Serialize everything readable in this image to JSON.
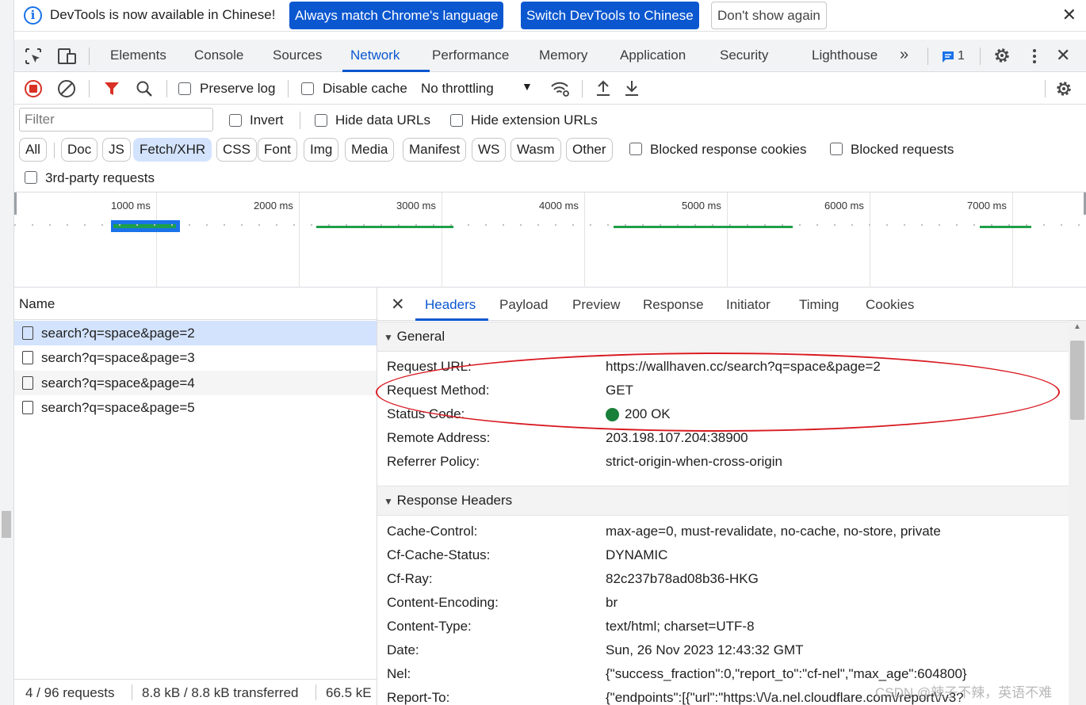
{
  "infobar": {
    "message": "DevTools is now available in Chinese!",
    "btn_match": "Always match Chrome's language",
    "btn_switch": "Switch DevTools to Chinese",
    "btn_dont_show": "Don't show again"
  },
  "tabs": [
    "Elements",
    "Console",
    "Sources",
    "Network",
    "Performance",
    "Memory",
    "Application",
    "Security",
    "Lighthouse"
  ],
  "tabs_issue_count": "1",
  "toolbar": {
    "preserve_log": "Preserve log",
    "disable_cache": "Disable cache",
    "throttling": "No throttling"
  },
  "filter": {
    "placeholder": "Filter",
    "invert": "Invert",
    "hide_data_urls": "Hide data URLs",
    "hide_extension_urls": "Hide extension URLs",
    "types": [
      "All",
      "Doc",
      "JS",
      "Fetch/XHR",
      "CSS",
      "Font",
      "Img",
      "Media",
      "Manifest",
      "WS",
      "Wasm",
      "Other"
    ],
    "blocked_response_cookies": "Blocked response cookies",
    "blocked_requests": "Blocked requests",
    "third_party": "3rd-party requests"
  },
  "overview": {
    "ticks": [
      "1000 ms",
      "2000 ms",
      "3000 ms",
      "4000 ms",
      "5000 ms",
      "6000 ms",
      "7000 ms"
    ]
  },
  "requests": {
    "header": "Name",
    "items": [
      "search?q=space&page=2",
      "search?q=space&page=3",
      "search?q=space&page=4",
      "search?q=space&page=5"
    ],
    "status_count": "4 / 96 requests",
    "status_transferred": "8.8 kB / 8.8 kB transferred",
    "status_resources": "66.5 kE"
  },
  "detail": {
    "tabs": [
      "Headers",
      "Payload",
      "Preview",
      "Response",
      "Initiator",
      "Timing",
      "Cookies"
    ],
    "general_title": "General",
    "general": [
      {
        "k": "Request URL:",
        "v": "https://wallhaven.cc/search?q=space&page=2"
      },
      {
        "k": "Request Method:",
        "v": "GET"
      },
      {
        "k": "Status Code:",
        "v": "200 OK"
      },
      {
        "k": "Remote Address:",
        "v": "203.198.107.204:38900"
      },
      {
        "k": "Referrer Policy:",
        "v": "strict-origin-when-cross-origin"
      }
    ],
    "response_title": "Response Headers",
    "response": [
      {
        "k": "Cache-Control:",
        "v": "max-age=0, must-revalidate, no-cache, no-store, private"
      },
      {
        "k": "Cf-Cache-Status:",
        "v": "DYNAMIC"
      },
      {
        "k": "Cf-Ray:",
        "v": "82c237b78ad08b36-HKG"
      },
      {
        "k": "Content-Encoding:",
        "v": "br"
      },
      {
        "k": "Content-Type:",
        "v": "text/html; charset=UTF-8"
      },
      {
        "k": "Date:",
        "v": "Sun, 26 Nov 2023 12:43:32 GMT"
      },
      {
        "k": "Nel:",
        "v": "{\"success_fraction\":0,\"report_to\":\"cf-nel\",\"max_age\":604800}"
      },
      {
        "k": "Report-To:",
        "v": "{\"endpoints\":[{\"url\":\"https:\\/\\/a.nel.cloudflare.com\\/report\\/v3?"
      }
    ]
  },
  "watermark": "CSDN @辣子不辣，英语不难",
  "colors": {
    "accent": "#0b57d0",
    "status_ok": "#188038",
    "record_red": "#d93025",
    "annotation": "#d81b22"
  }
}
